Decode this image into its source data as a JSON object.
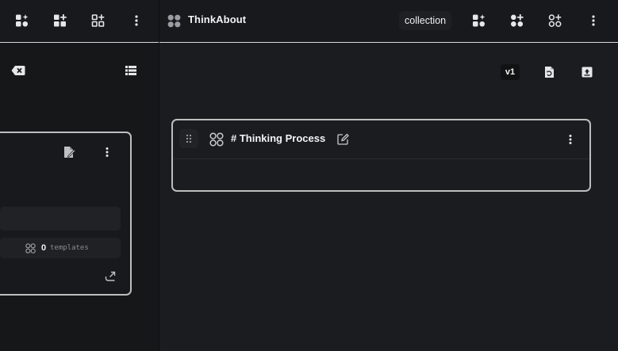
{
  "app": {
    "title": "ThinkAbout"
  },
  "header": {
    "collection_label": "collection"
  },
  "left_panel": {
    "templates": {
      "count": "0",
      "label": "templates"
    }
  },
  "right_panel": {
    "version_label": "v1",
    "card": {
      "title": "# Thinking Process"
    }
  },
  "icons": {
    "left_toolbar": [
      "add-shapes-sparkle-icon",
      "add-squares-icon",
      "add-squares-outline-icon",
      "more-vertical-icon"
    ],
    "right_toolbar": [
      "add-shapes-sparkle-icon",
      "add-circles-icon",
      "add-circles-outline-icon",
      "more-vertical-icon"
    ],
    "left_panel": [
      "clear-input-icon",
      "list-icon",
      "edit-document-icon",
      "more-vertical-icon",
      "circles-outline-icon",
      "expand-corner-icon"
    ],
    "right_panel": [
      "restore-file-icon",
      "upload-box-icon",
      "drag-handle-icon",
      "circles-outline-icon",
      "edit-icon",
      "more-vertical-icon"
    ]
  },
  "colors": {
    "background": "#1b1c20",
    "sidebar": "#161719",
    "card_border": "#bdbdbd",
    "text": "#f2f2f3"
  }
}
